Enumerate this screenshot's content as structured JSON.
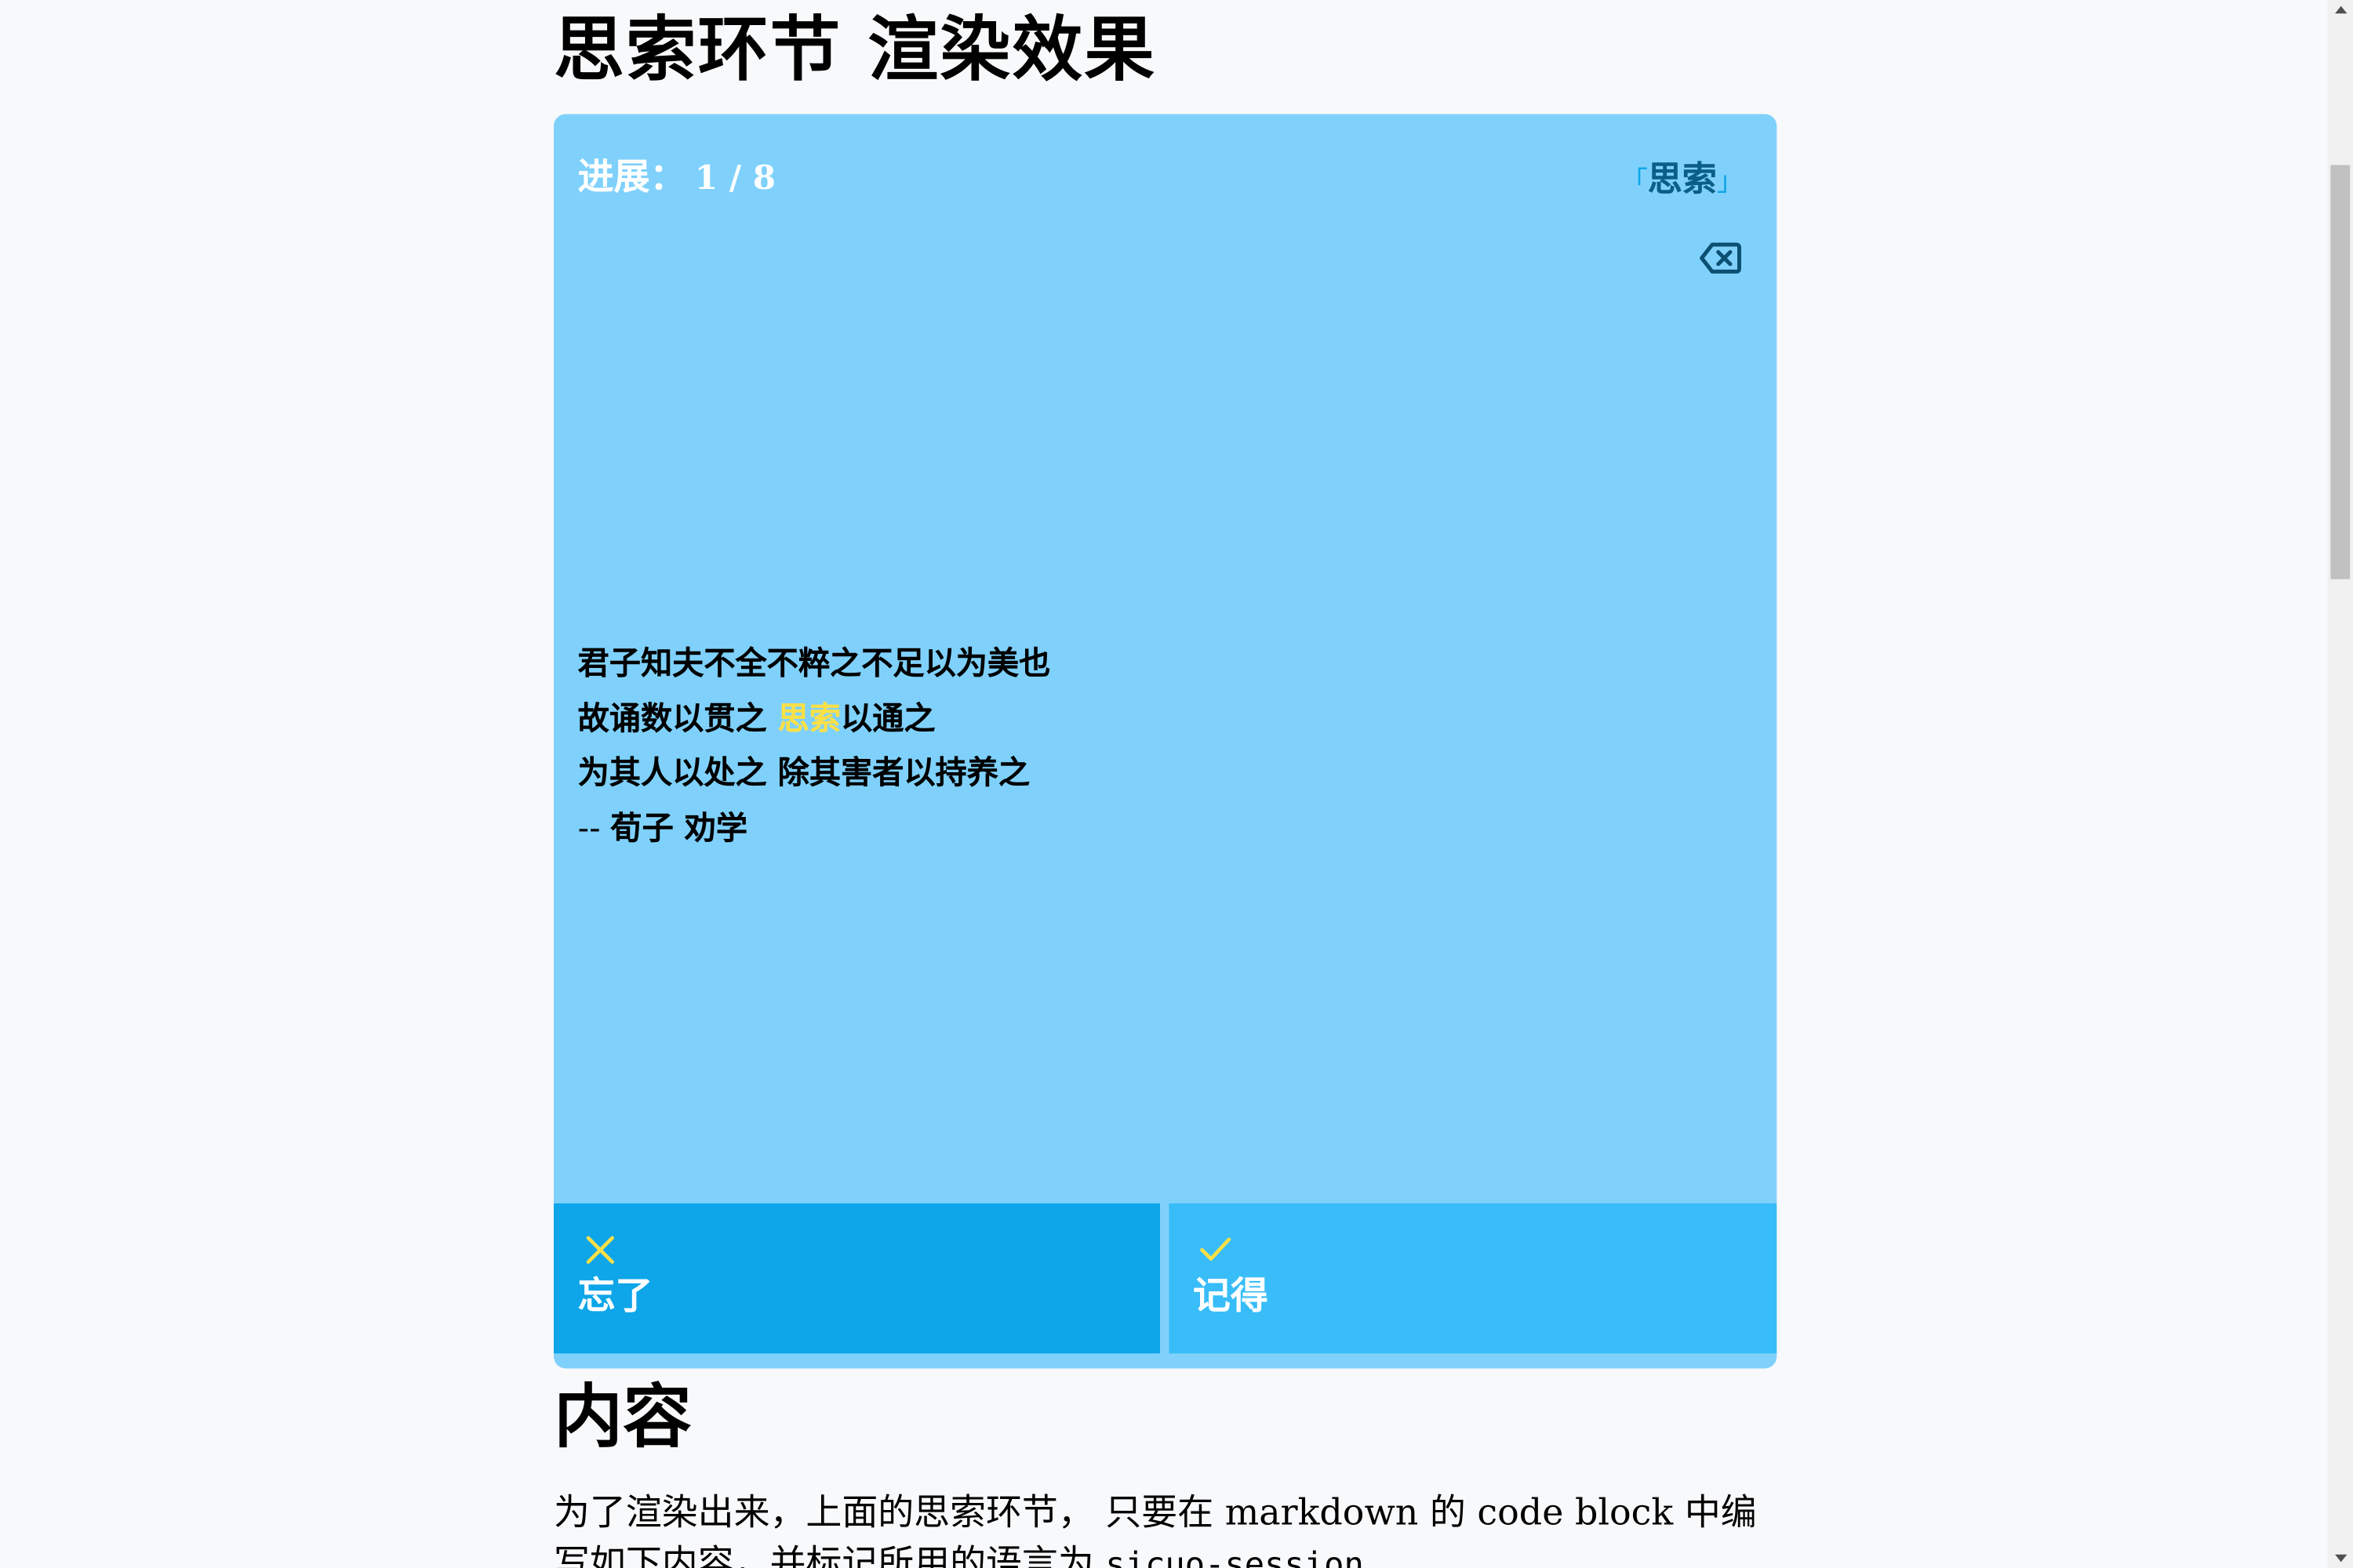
{
  "page": {
    "title": "思索环节 渲染效果"
  },
  "card": {
    "progress_label": "进展：",
    "progress_value": "1 / 8",
    "tag_open": "「",
    "tag_text": "思索",
    "tag_close": "」",
    "delete_icon": "backspace-x-icon",
    "lines": {
      "l1": "君子知夫不全不粹之不足以为美也",
      "l2_pre": "故诵数以贯之 ",
      "l2_highlight": "思索",
      "l2_post": "以通之",
      "l3": "为其人以处之 除其害者以持养之",
      "l4_dash": "-- ",
      "l4": "荀子 劝学"
    },
    "colors": {
      "card_bg": "#7fd1fb",
      "highlight": "#fde047",
      "forgot_bg": "#0ea5e9",
      "remember_bg": "#38bdf8"
    }
  },
  "actions": {
    "forgot": {
      "icon": "x-icon",
      "label": "忘了"
    },
    "remember": {
      "icon": "check-icon",
      "label": "记得"
    }
  },
  "section": {
    "heading": "内容",
    "para_l1": "为了渲染出来，上面的思索环节， 只要在 markdown 的 code block 中编",
    "para_l2_pre": "写如下内容，并标记所用的语言为 ",
    "para_l2_code": "sicuo-session"
  }
}
